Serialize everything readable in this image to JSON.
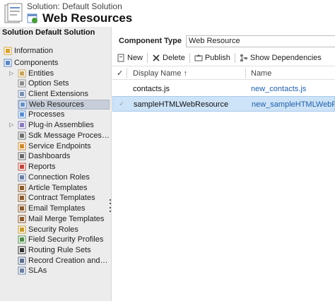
{
  "header": {
    "solution_line": "Solution: Default Solution",
    "title": "Web Resources"
  },
  "sidebar": {
    "title": "Solution Default Solution",
    "items": [
      {
        "label": "Information",
        "icon": "information-icon",
        "color": "#d9a232"
      },
      {
        "label": "Components",
        "icon": "components-icon",
        "color": "#5b86c5"
      },
      {
        "label": "Entities",
        "icon": "entities-icon",
        "color": "#c8a35b"
      },
      {
        "label": "Option Sets",
        "icon": "option-sets-icon",
        "color": "#8a8a8a"
      },
      {
        "label": "Client Extensions",
        "icon": "client-extensions-icon",
        "color": "#7a8fb0"
      },
      {
        "label": "Web Resources",
        "icon": "web-resources-icon",
        "color": "#6a8fc4"
      },
      {
        "label": "Processes",
        "icon": "processes-icon",
        "color": "#5b8fcf"
      },
      {
        "label": "Plug-in Assemblies",
        "icon": "plugin-assemblies-icon",
        "color": "#8a7bb8"
      },
      {
        "label": "Sdk Message Processing S...",
        "icon": "sdk-message-icon",
        "color": "#6f6f6f"
      },
      {
        "label": "Service Endpoints",
        "icon": "service-endpoints-icon",
        "color": "#d28a2e"
      },
      {
        "label": "Dashboards",
        "icon": "dashboards-icon",
        "color": "#6a6a6a"
      },
      {
        "label": "Reports",
        "icon": "reports-icon",
        "color": "#c0463c"
      },
      {
        "label": "Connection Roles",
        "icon": "connection-roles-icon",
        "color": "#6c7fa6"
      },
      {
        "label": "Article Templates",
        "icon": "article-templates-icon",
        "color": "#8b5a2b"
      },
      {
        "label": "Contract Templates",
        "icon": "contract-templates-icon",
        "color": "#8b5a2b"
      },
      {
        "label": "Email Templates",
        "icon": "email-templates-icon",
        "color": "#8b5a2b"
      },
      {
        "label": "Mail Merge Templates",
        "icon": "mail-merge-templates-icon",
        "color": "#8b5a2b"
      },
      {
        "label": "Security Roles",
        "icon": "security-roles-icon",
        "color": "#c79a2a"
      },
      {
        "label": "Field Security Profiles",
        "icon": "field-security-profiles-icon",
        "color": "#4f8b4a"
      },
      {
        "label": "Routing Rule Sets",
        "icon": "routing-rule-sets-icon",
        "color": "#333333"
      },
      {
        "label": "Record Creation and Upda...",
        "icon": "record-creation-icon",
        "color": "#5a6e8c"
      },
      {
        "label": "SLAs",
        "icon": "slas-icon",
        "color": "#6a7fa0"
      }
    ]
  },
  "component_type": {
    "label": "Component Type",
    "value": "Web Resource"
  },
  "toolbar": {
    "new_label": "New",
    "delete_label": "Delete",
    "publish_label": "Publish",
    "show_dependencies_label": "Show Dependencies"
  },
  "grid": {
    "columns": [
      "Display Name ↑",
      "Name"
    ],
    "rows": [
      {
        "display_name": "contacts.js",
        "name": "new_contacts.js",
        "selected": false
      },
      {
        "display_name": "sampleHTMLWebResource",
        "name": "new_sampleHTMLWebRes...",
        "selected": true
      }
    ]
  },
  "colors": {
    "selection": "#cde3f7",
    "sidebar_bg": "#ececec",
    "link": "#1f5fa8"
  }
}
